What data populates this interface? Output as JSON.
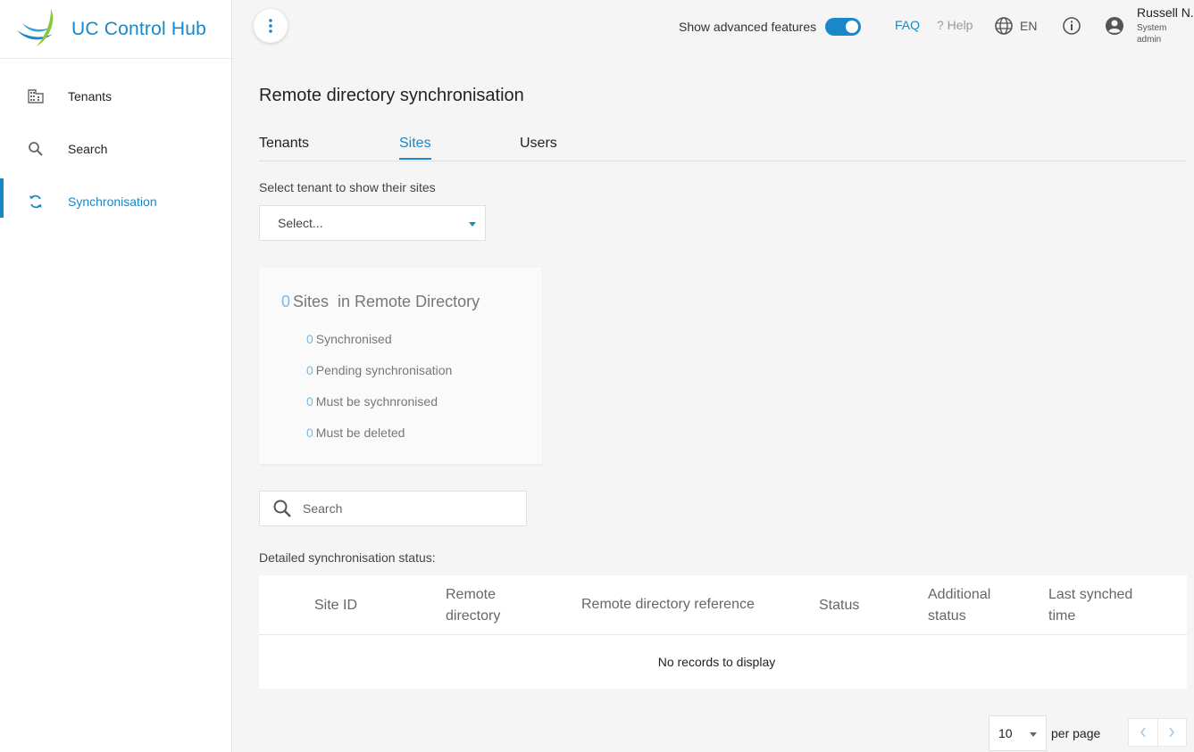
{
  "brand": {
    "name": "UC Control Hub",
    "logo_icon": "brand-logo-icon"
  },
  "sidebar": {
    "items": [
      {
        "label": "Tenants",
        "icon": "building-icon",
        "active": false
      },
      {
        "label": "Search",
        "icon": "search-icon",
        "active": false
      },
      {
        "label": "Synchronisation",
        "icon": "sync-icon",
        "active": true
      }
    ]
  },
  "header": {
    "advanced_label": "Show advanced features",
    "advanced_on": true,
    "faq": "FAQ",
    "help": "? Help",
    "language": "EN",
    "user_name": "Russell N.",
    "user_role": "System admin"
  },
  "main": {
    "title": "Remote directory synchronisation",
    "tabs": [
      {
        "label": "Tenants",
        "active": false
      },
      {
        "label": "Sites",
        "active": true
      },
      {
        "label": "Users",
        "active": false
      }
    ],
    "select_label": "Select tenant to show their sites",
    "select_value": "Select...",
    "summary": {
      "count": "0",
      "title": "Sites  in Remote Directory",
      "stats": [
        {
          "count": "0",
          "label": "Synchronised"
        },
        {
          "count": "0",
          "label": "Pending synchronisation"
        },
        {
          "count": "0",
          "label": "Must be sychnronised"
        },
        {
          "count": "0",
          "label": "Must be deleted"
        }
      ]
    },
    "search_placeholder": "Search",
    "detail_label": "Detailed synchronisation status:",
    "table": {
      "columns": [
        "Site ID",
        "Remote directory",
        "Remote directory reference",
        "Status",
        "Additional status",
        "Last synched time"
      ],
      "empty": "No records to display"
    },
    "pagination": {
      "page_size": "10",
      "per_page_label": "per page"
    }
  },
  "colors": {
    "accent": "#1a87c8",
    "muted_number": "#7ab8e0"
  }
}
